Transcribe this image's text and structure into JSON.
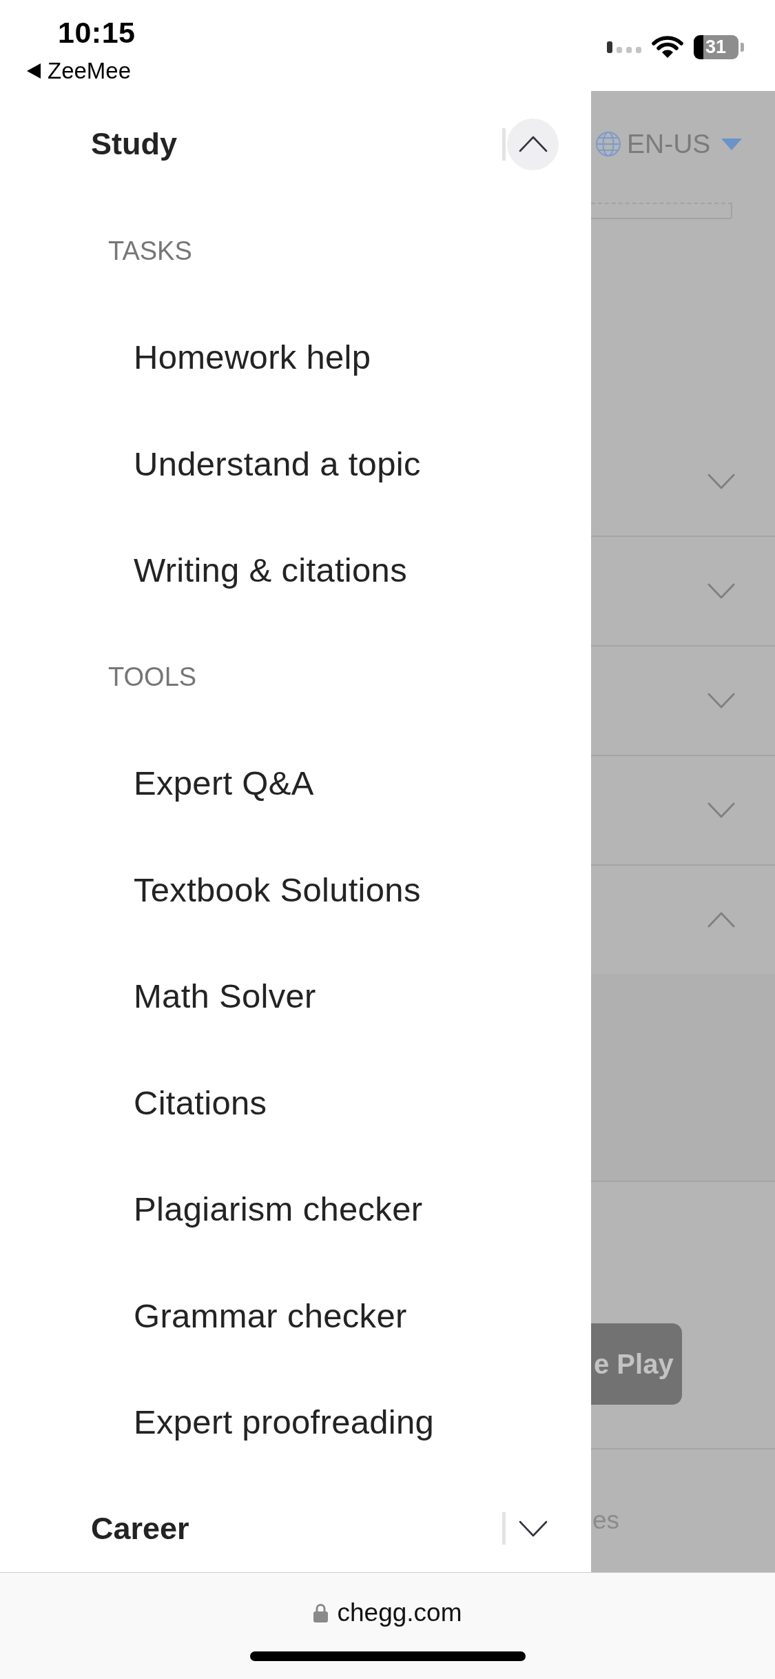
{
  "status_bar": {
    "time": "10:15",
    "back_label": "ZeeMee",
    "battery": "31"
  },
  "menu": {
    "sections": [
      {
        "title": "Study",
        "expanded": true,
        "focused": true,
        "groups": [
          {
            "heading": "TASKS",
            "items": [
              "Homework help",
              "Understand a topic",
              "Writing & citations"
            ]
          },
          {
            "heading": "TOOLS",
            "items": [
              "Expert Q&A",
              "Textbook Solutions",
              "Math Solver",
              "Citations",
              "Plagiarism checker",
              "Grammar checker",
              "Expert proofreading"
            ]
          }
        ]
      },
      {
        "title": "Career",
        "expanded": false,
        "focused": false
      }
    ]
  },
  "background_page": {
    "language": "EN-US",
    "rows": [
      {
        "expanded": false
      },
      {
        "expanded": false
      },
      {
        "expanded": false
      },
      {
        "expanded": false
      },
      {
        "expanded": true
      }
    ],
    "store_button": "e Play",
    "footer_text": "es"
  },
  "browser": {
    "url": "chegg.com"
  }
}
